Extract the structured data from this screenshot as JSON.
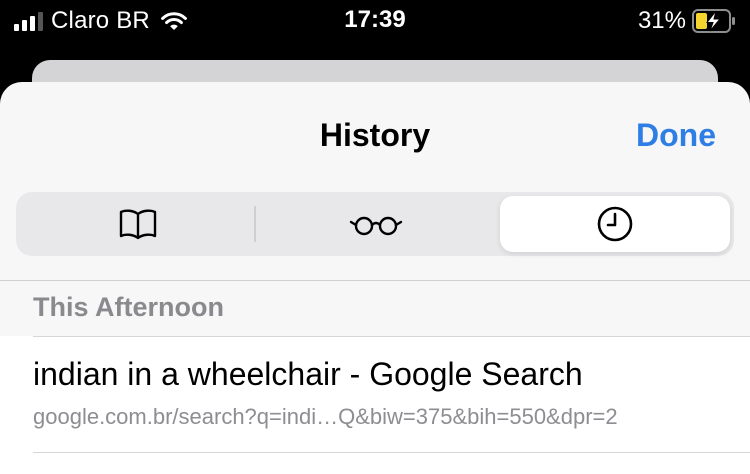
{
  "status_bar": {
    "carrier": "Claro BR",
    "time": "17:39",
    "battery_percent": "31%",
    "icons": [
      "signal-icon",
      "wifi-icon",
      "battery-charging-icon"
    ]
  },
  "sheet": {
    "title": "History",
    "done_label": "Done",
    "segments": [
      {
        "icon": "book-icon",
        "selected": false
      },
      {
        "icon": "reading-list-glasses-icon",
        "selected": false
      },
      {
        "icon": "clock-icon",
        "selected": true
      }
    ],
    "section_header": "This Afternoon",
    "items": [
      {
        "title": "indian in a wheelchair - Google Search",
        "url": "google.com.br/search?q=indi…Q&biw=375&bih=550&dpr=2"
      }
    ]
  },
  "colors": {
    "accent": "#2f7ee5",
    "sheet_bg": "#f7f7f7",
    "secondary_text": "#8a8a8e",
    "battery_charging": "#f5d430"
  }
}
